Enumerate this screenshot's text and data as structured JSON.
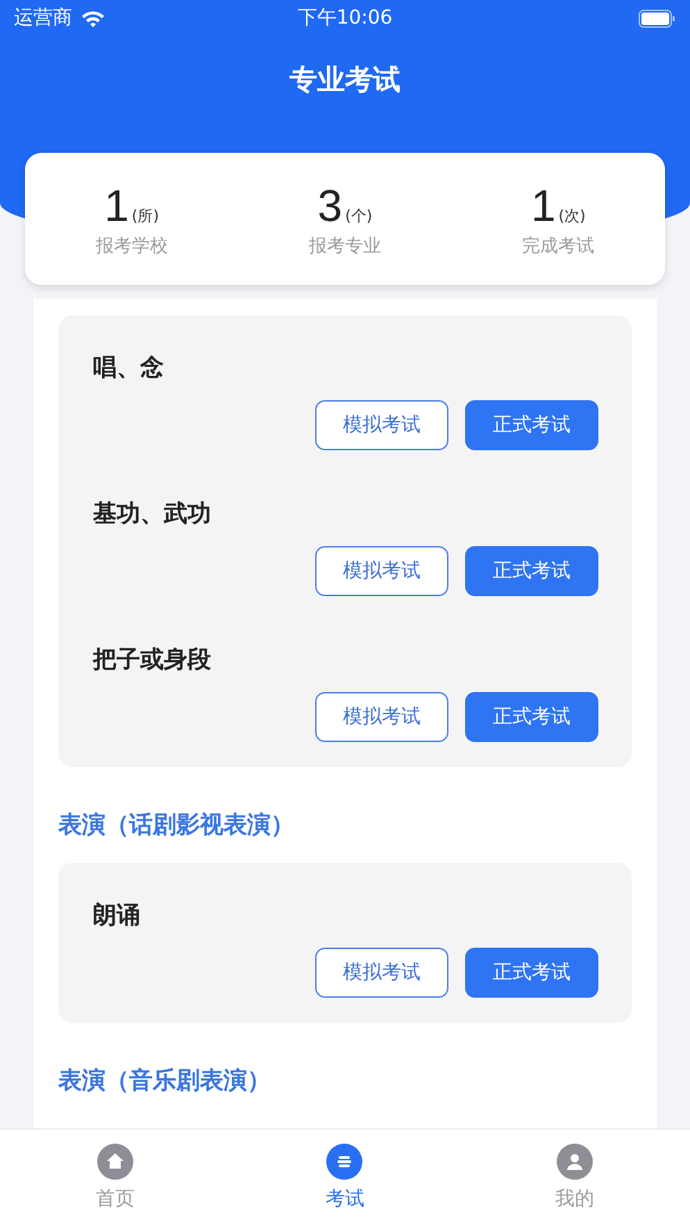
{
  "status_bar": {
    "carrier": "运营商",
    "time": "下午10:06"
  },
  "header": {
    "title": "专业考试"
  },
  "stats": [
    {
      "value": "1",
      "unit": "(所)",
      "label": "报考学校"
    },
    {
      "value": "3",
      "unit": "(个)",
      "label": "报考专业"
    },
    {
      "value": "1",
      "unit": "(次)",
      "label": "完成考试"
    }
  ],
  "sections": [
    {
      "items": [
        {
          "title": "唱、念",
          "buttons": [
            "模拟考试",
            "正式考试"
          ]
        },
        {
          "title": "基功、武功",
          "buttons": [
            "模拟考试",
            "正式考试"
          ]
        },
        {
          "title": "把子或身段",
          "buttons": [
            "模拟考试",
            "正式考试"
          ]
        }
      ]
    },
    {
      "heading": "表演（话剧影视表演）",
      "items": [
        {
          "title": "朗诵",
          "buttons": [
            "模拟考试",
            "正式考试"
          ]
        }
      ]
    },
    {
      "heading": "表演（音乐剧表演）"
    }
  ],
  "tab_bar": [
    {
      "label": "首页",
      "kind": "home",
      "selected": false
    },
    {
      "label": "考试",
      "kind": "exam",
      "selected": true
    },
    {
      "label": "我的",
      "kind": "user",
      "selected": false
    }
  ]
}
